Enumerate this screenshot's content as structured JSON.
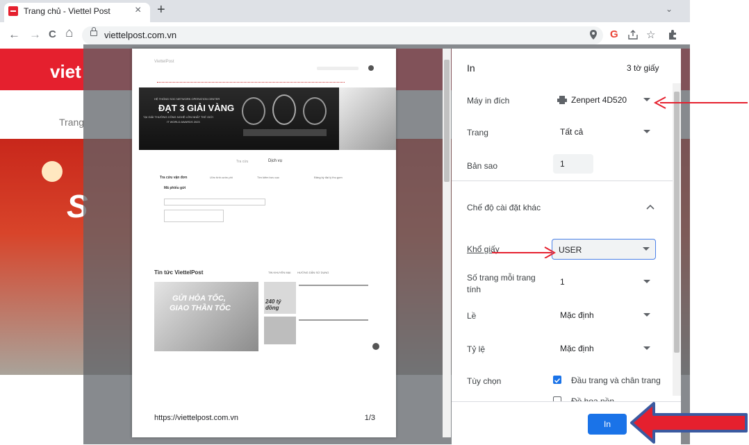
{
  "browser": {
    "tab_title": "Trang chủ - Viettel Post",
    "tab_close": "×",
    "new_tab": "+",
    "tab_search": "⌄",
    "back": "←",
    "forward": "→",
    "reload": "C",
    "home": "⌂",
    "url": "viettelpost.com.vn",
    "icons": [
      "location-icon",
      "google-icon",
      "share-icon",
      "star-icon",
      "extensions-icon"
    ]
  },
  "background_page": {
    "logo": "viet",
    "nav_item": "Trang",
    "banner_letter": "S"
  },
  "preview": {
    "footer_url": "https://viettelpost.com.vn",
    "page_indicator": "1/3",
    "banner_line1": "HỆ THỐNG SOC NETWORK OPERATION CENTER",
    "banner_title": "ĐẠT 3 GIẢI VÀNG",
    "banner_line2": "TẠI GIẢI THƯỞNG CÔNG NGHỆ LỚN NHẤT THẾ GIỚI",
    "banner_line3": "IT WORLD AWARDS 2023",
    "tab_a": "Tra cứu",
    "tab_b": "Dịch vụ",
    "sub_tabs": [
      "Tra cứu vận đơn",
      "Ước tính cước phí",
      "Tìm kiếm bưu cục",
      "Đăng ký đại lý thu gom"
    ],
    "order_label": "Mã phiếu gửi",
    "news_title": "Tin tức ViettelPost",
    "news_tabs": [
      "TIN KHUYẾN MẠI",
      "HƯỚNG DẪN SỬ DỤNG"
    ],
    "news_main_1": "GỬI HỎA TỐC,",
    "news_main_2": "GIAO THẦN TỐC",
    "news_amount": "240 tỷ đồng"
  },
  "print_dialog": {
    "title": "In",
    "sheets": "3 tờ giấy",
    "destination_label": "Máy in đích",
    "destination_value": "Zenpert 4D520",
    "pages_label": "Trang",
    "pages_value": "Tất cả",
    "copies_label": "Bản sao",
    "copies_value": "1",
    "more_settings_label": "Chế độ cài đặt khác",
    "paper_size_label": "Khổ giấy",
    "paper_size_value": "USER",
    "pages_per_sheet_label_1": "Số trang mỗi trang",
    "pages_per_sheet_label_2": "tính",
    "pages_per_sheet_value": "1",
    "margins_label": "Lề",
    "margins_value": "Mặc định",
    "scale_label": "Tỷ lệ",
    "scale_value": "Mặc định",
    "options_label": "Tùy chọn",
    "option_headers": "Đầu trang và chân trang",
    "option_headers_checked": true,
    "option_background": "Đồ họa nền",
    "print_button": "In",
    "accent_color": "#1a73e8"
  },
  "annotations": {
    "arrow_color": "#e5202e",
    "big_arrow_border": "#3b5aa0"
  }
}
